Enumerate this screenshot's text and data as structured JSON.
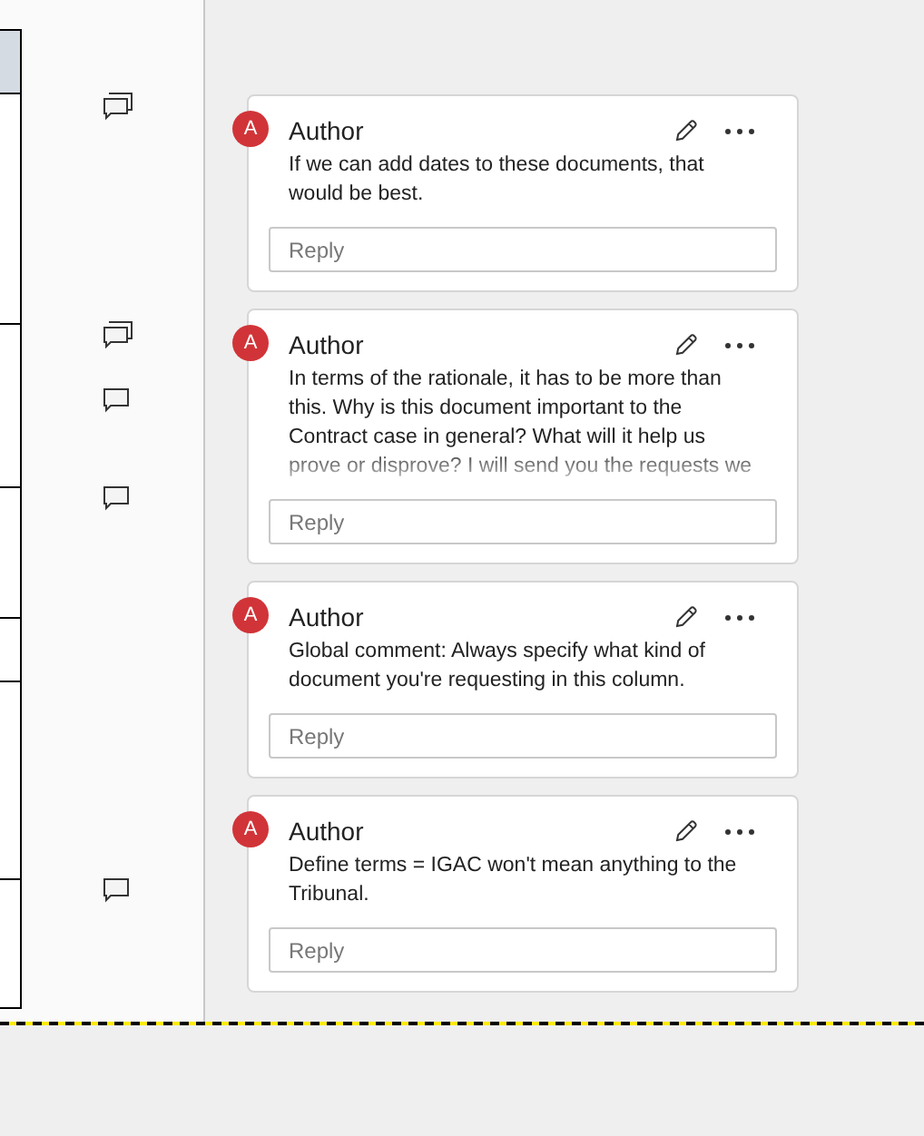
{
  "document": {
    "comment_markers": [
      {
        "kind": "thread"
      },
      {
        "kind": "thread"
      },
      {
        "kind": "single"
      },
      {
        "kind": "single"
      },
      {
        "kind": "single"
      }
    ]
  },
  "comments": [
    {
      "avatar": "A",
      "author": "Author",
      "lines": [
        "If we can add dates to these documents, that",
        "would be best."
      ],
      "reply_placeholder": "Reply",
      "truncated": false
    },
    {
      "avatar": "A",
      "author": "Author",
      "lines": [
        "In terms of the rationale, it has to be more than",
        "this. Why is this document important to the",
        "Contract case in general? What will it help us",
        "prove or disprove? I will send you the requests we"
      ],
      "reply_placeholder": "Reply",
      "truncated": true
    },
    {
      "avatar": "A",
      "author": "Author",
      "lines": [
        "Global comment: Always specify what kind of",
        "document you're requesting in this column."
      ],
      "reply_placeholder": "Reply",
      "truncated": false
    },
    {
      "avatar": "A",
      "author": "Author",
      "lines": [
        "Define terms = IGAC won't mean anything to the",
        "Tribunal."
      ],
      "reply_placeholder": "Reply",
      "truncated": false
    }
  ]
}
